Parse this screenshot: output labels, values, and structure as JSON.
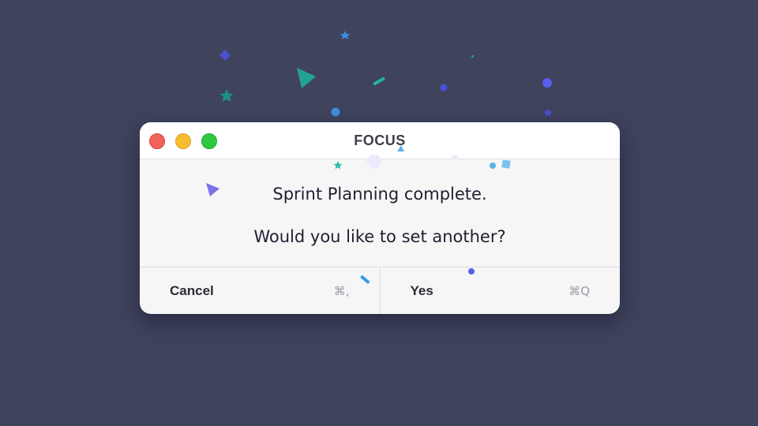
{
  "window": {
    "title": "FOCUS",
    "controls": [
      "close",
      "minimize",
      "maximize"
    ]
  },
  "message": {
    "line1": "Sprint Planning complete.",
    "line2": "Would you like to set another?"
  },
  "buttons": {
    "cancel": {
      "label": "Cancel",
      "shortcut": "⌘,"
    },
    "yes": {
      "label": "Yes",
      "shortcut": "⌘Q"
    }
  },
  "colors": {
    "background": "#3f435c",
    "dialog": "#f6f6f7",
    "close": "#f0625a",
    "minimize": "#f8bd2e",
    "maximize": "#2cc840"
  }
}
